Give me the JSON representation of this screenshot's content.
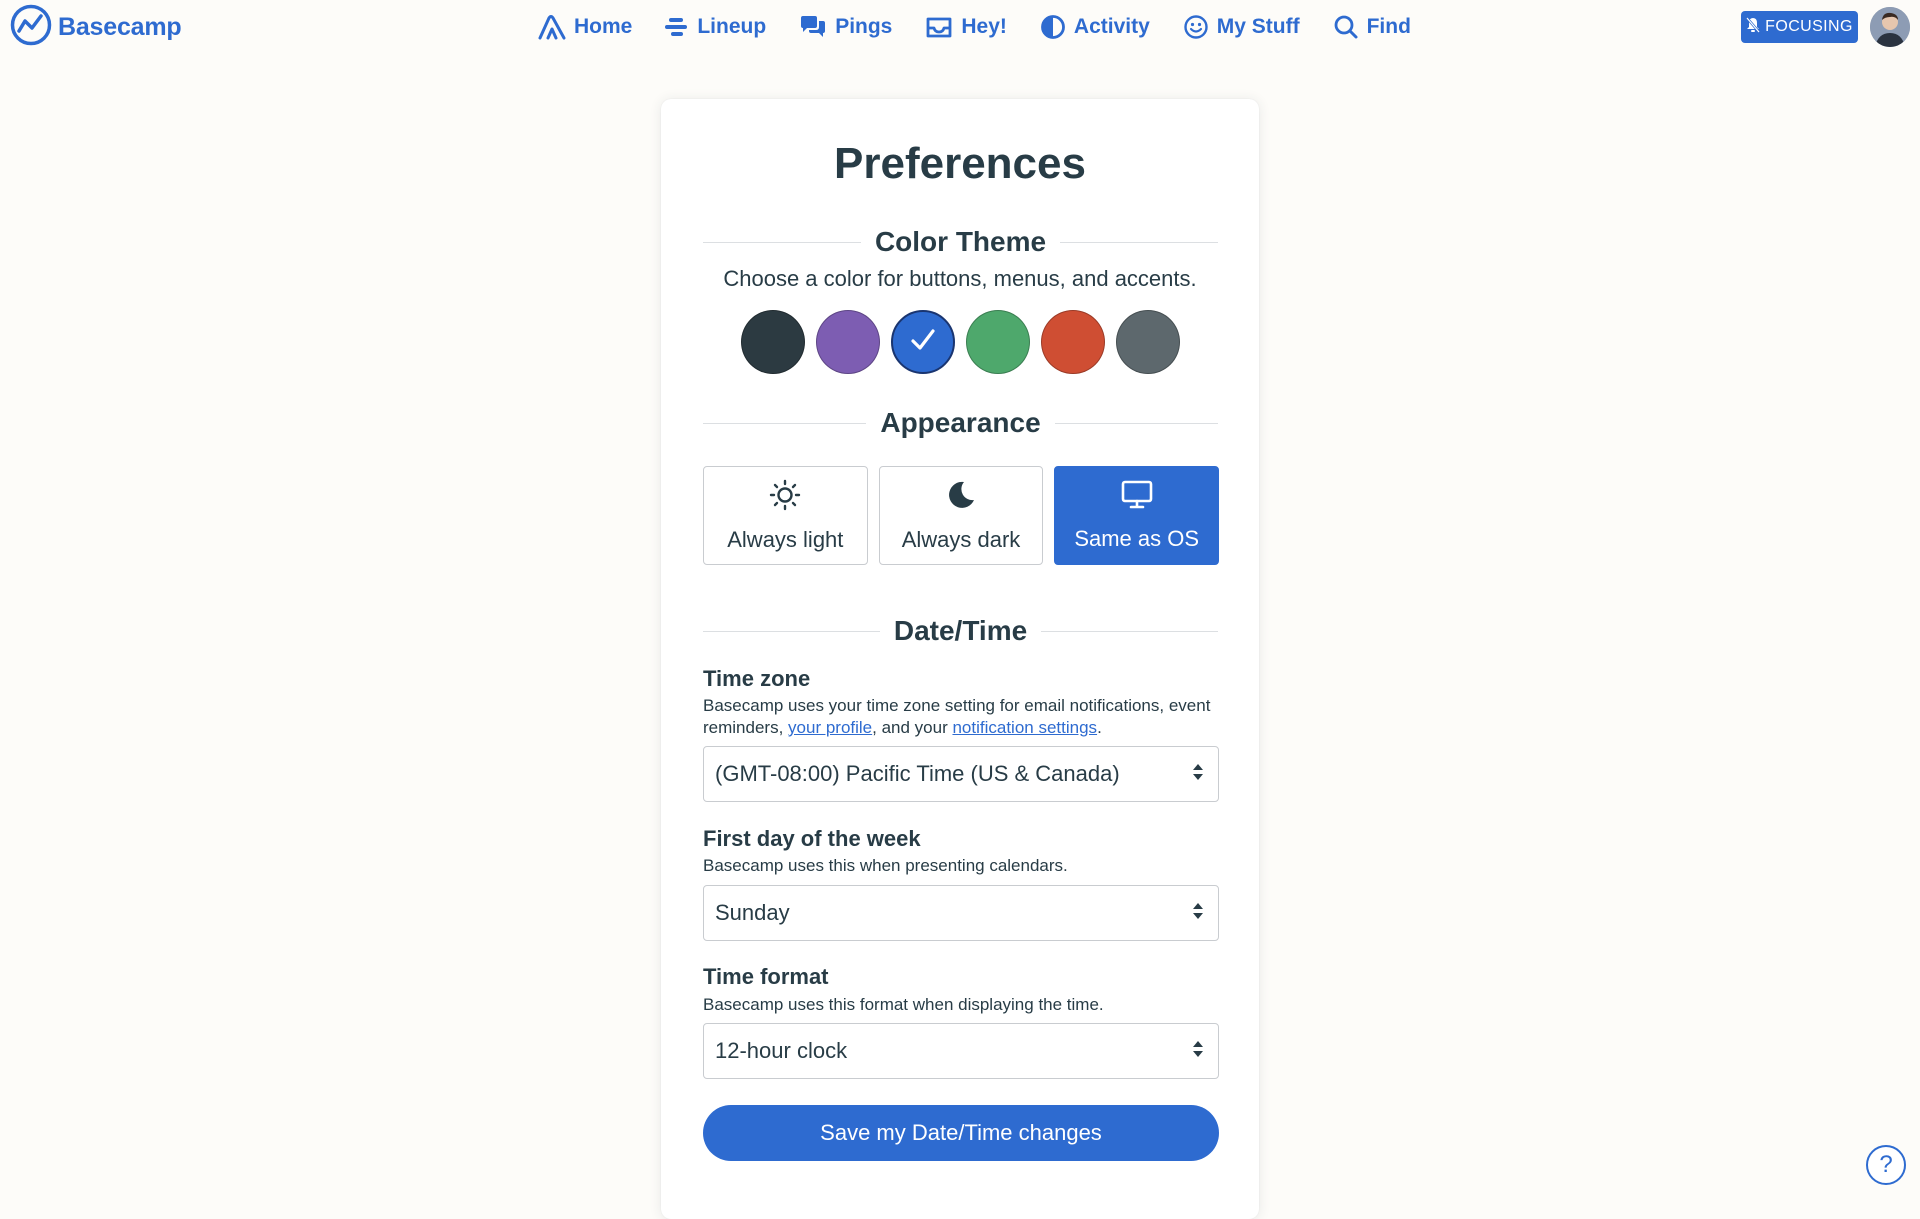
{
  "app": {
    "name": "Basecamp"
  },
  "nav": {
    "items": [
      {
        "label": "Home",
        "icon": "home-icon"
      },
      {
        "label": "Lineup",
        "icon": "lineup-icon"
      },
      {
        "label": "Pings",
        "icon": "pings-icon"
      },
      {
        "label": "Hey!",
        "icon": "inbox-icon"
      },
      {
        "label": "Activity",
        "icon": "activity-icon"
      },
      {
        "label": "My Stuff",
        "icon": "smiley-icon"
      },
      {
        "label": "Find",
        "icon": "search-icon"
      }
    ],
    "focus_badge": "FOCUSING"
  },
  "page": {
    "title": "Preferences"
  },
  "color_theme": {
    "heading": "Color Theme",
    "description": "Choose a color for buttons, menus, and accents.",
    "swatches": [
      {
        "name": "charcoal",
        "color": "#2c3a41"
      },
      {
        "name": "purple",
        "color": "#7d5db2"
      },
      {
        "name": "blue",
        "color": "#2e6bd0",
        "selected": true
      },
      {
        "name": "green",
        "color": "#4ea86c"
      },
      {
        "name": "red",
        "color": "#cf4e33"
      },
      {
        "name": "gray",
        "color": "#5d686d"
      }
    ]
  },
  "appearance": {
    "heading": "Appearance",
    "options": [
      {
        "label": "Always light",
        "icon": "sun-icon"
      },
      {
        "label": "Always dark",
        "icon": "moon-icon"
      },
      {
        "label": "Same as OS",
        "icon": "monitor-icon",
        "selected": true
      }
    ]
  },
  "datetime": {
    "heading": "Date/Time",
    "time_zone": {
      "label": "Time zone",
      "help_prefix": "Basecamp uses your time zone setting for email notifications, event reminders, ",
      "help_link1": "your profile",
      "help_mid": ", and your ",
      "help_link2": "notification settings",
      "help_suffix": ".",
      "value": "(GMT-08:00) Pacific Time (US & Canada)"
    },
    "first_day": {
      "label": "First day of the week",
      "help": "Basecamp uses this when presenting calendars.",
      "value": "Sunday"
    },
    "time_format": {
      "label": "Time format",
      "help": "Basecamp uses this format when displaying the time.",
      "value": "12-hour clock"
    },
    "save_label": "Save my Date/Time changes"
  },
  "help": {
    "label": "?"
  },
  "colors": {
    "accent": "#2e6bd0",
    "text": "#283c46",
    "background": "#fdfcf9"
  }
}
